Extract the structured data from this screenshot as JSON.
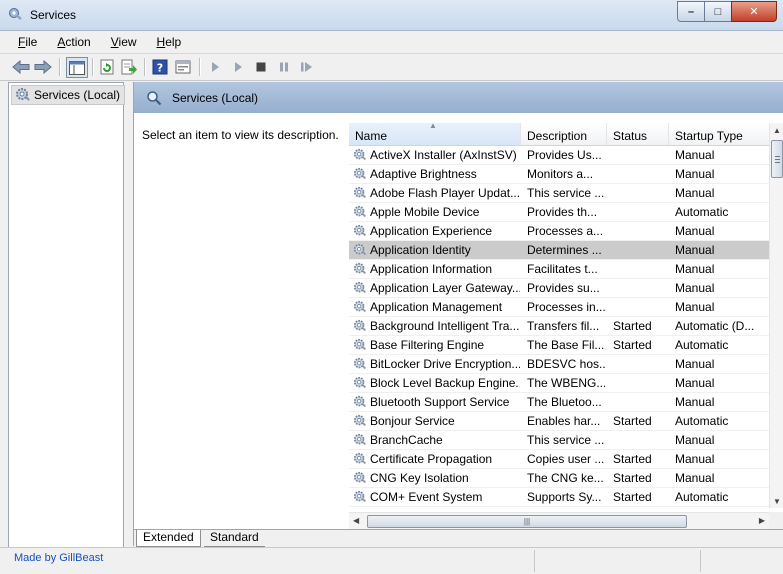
{
  "window": {
    "title": "Services",
    "minimize": "–",
    "maximize": "□",
    "close": "✕"
  },
  "menu": [
    {
      "key": "F",
      "rest": "ile"
    },
    {
      "key": "A",
      "rest": "ction"
    },
    {
      "key": "V",
      "rest": "iew"
    },
    {
      "key": "H",
      "rest": "elp"
    }
  ],
  "toolbar_icons": [
    "back-arrow-icon",
    "forward-arrow-icon",
    "show-hide-console-tree-icon",
    "refresh-icon",
    "export-list-icon",
    "help-icon",
    "properties-icon",
    "start-service-icon",
    "start-service-alt-icon",
    "stop-service-icon",
    "pause-service-icon",
    "resume-service-icon"
  ],
  "tree": {
    "root": "Services (Local)"
  },
  "panel": {
    "header": "Services (Local)",
    "description_hint": "Select an item to view its description."
  },
  "columns": {
    "name": "Name",
    "description": "Description",
    "status": "Status",
    "startup": "Startup Type"
  },
  "services": [
    {
      "name": "ActiveX Installer (AxInstSV)",
      "description": "Provides Us...",
      "status": "",
      "startup": "Manual"
    },
    {
      "name": "Adaptive Brightness",
      "description": "Monitors a...",
      "status": "",
      "startup": "Manual"
    },
    {
      "name": "Adobe Flash Player Updat...",
      "description": "This service ...",
      "status": "",
      "startup": "Manual"
    },
    {
      "name": "Apple Mobile Device",
      "description": "Provides th...",
      "status": "",
      "startup": "Automatic"
    },
    {
      "name": "Application Experience",
      "description": "Processes a...",
      "status": "",
      "startup": "Manual"
    },
    {
      "name": "Application Identity",
      "description": "Determines ...",
      "status": "",
      "startup": "Manual",
      "selected": true
    },
    {
      "name": "Application Information",
      "description": "Facilitates t...",
      "status": "",
      "startup": "Manual"
    },
    {
      "name": "Application Layer Gateway...",
      "description": "Provides su...",
      "status": "",
      "startup": "Manual"
    },
    {
      "name": "Application Management",
      "description": "Processes in...",
      "status": "",
      "startup": "Manual"
    },
    {
      "name": "Background Intelligent Tra...",
      "description": "Transfers fil...",
      "status": "Started",
      "startup": "Automatic (D..."
    },
    {
      "name": "Base Filtering Engine",
      "description": "The Base Fil...",
      "status": "Started",
      "startup": "Automatic"
    },
    {
      "name": "BitLocker Drive Encryption...",
      "description": "BDESVC hos...",
      "status": "",
      "startup": "Manual"
    },
    {
      "name": "Block Level Backup Engine...",
      "description": "The WBENG...",
      "status": "",
      "startup": "Manual"
    },
    {
      "name": "Bluetooth Support Service",
      "description": "The Bluetoo...",
      "status": "",
      "startup": "Manual"
    },
    {
      "name": "Bonjour Service",
      "description": "Enables har...",
      "status": "Started",
      "startup": "Automatic"
    },
    {
      "name": "BranchCache",
      "description": "This service ...",
      "status": "",
      "startup": "Manual"
    },
    {
      "name": "Certificate Propagation",
      "description": "Copies user ...",
      "status": "Started",
      "startup": "Manual"
    },
    {
      "name": "CNG Key Isolation",
      "description": "The CNG ke...",
      "status": "Started",
      "startup": "Manual"
    },
    {
      "name": "COM+ Event System",
      "description": "Supports Sy...",
      "status": "Started",
      "startup": "Automatic"
    }
  ],
  "tabs": {
    "extended": "Extended",
    "standard": "Standard"
  },
  "statusbar": {
    "credit": "Made by GillBeast"
  },
  "scroll": {
    "hgrip": "|||"
  }
}
